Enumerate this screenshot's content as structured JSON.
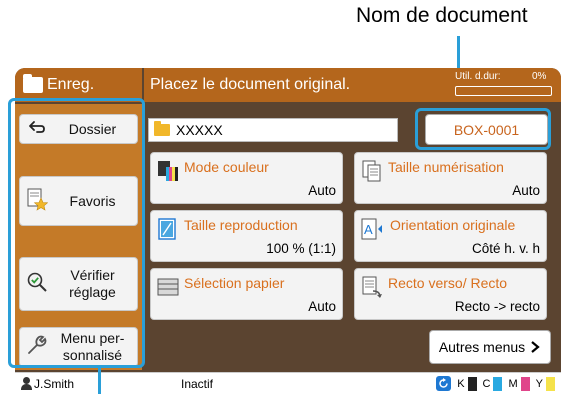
{
  "callouts": {
    "document_name": "Nom de document"
  },
  "header": {
    "mode_title": "Enreg.",
    "message": "Placez le document original.",
    "usage_label": "Util. d.dur:",
    "usage_percent": "0%",
    "usage_fraction": 0.0
  },
  "sidebar": {
    "dossier": "Dossier",
    "favoris": "Favoris",
    "verifier": "Vérifier réglage",
    "menu": "Menu per- sonnalisé"
  },
  "document": {
    "name_value": "XXXXX",
    "box_label": "BOX-0001"
  },
  "tiles": [
    {
      "label": "Mode couleur",
      "value": "Auto",
      "icon": "color-mode-icon"
    },
    {
      "label": "Taille numérisation",
      "value": "Auto",
      "icon": "scan-size-icon"
    },
    {
      "label": "Taille reproduction",
      "value": "100 % (1:1)",
      "icon": "reproduction-size-icon"
    },
    {
      "label": "Orientation originale",
      "value": "Côté h. v. h",
      "icon": "orientation-icon"
    },
    {
      "label": "Sélection papier",
      "value": "Auto",
      "icon": "paper-select-icon"
    },
    {
      "label": "Recto verso/ Recto",
      "value": "Recto -> recto",
      "icon": "duplex-icon"
    }
  ],
  "more_menus": "Autres menus",
  "status": {
    "user": "J.Smith",
    "state": "Inactif",
    "inks": [
      {
        "letter": "K",
        "color": "#222222"
      },
      {
        "letter": "C",
        "color": "#29a9e1"
      },
      {
        "letter": "M",
        "color": "#e0458a"
      },
      {
        "letter": "Y",
        "color": "#f5e24a"
      }
    ]
  },
  "colors": {
    "header_bg": "#b4661c",
    "sidebar_bg": "#c47a28",
    "accent_text": "#d9701e",
    "highlight": "#2a9fd8"
  }
}
